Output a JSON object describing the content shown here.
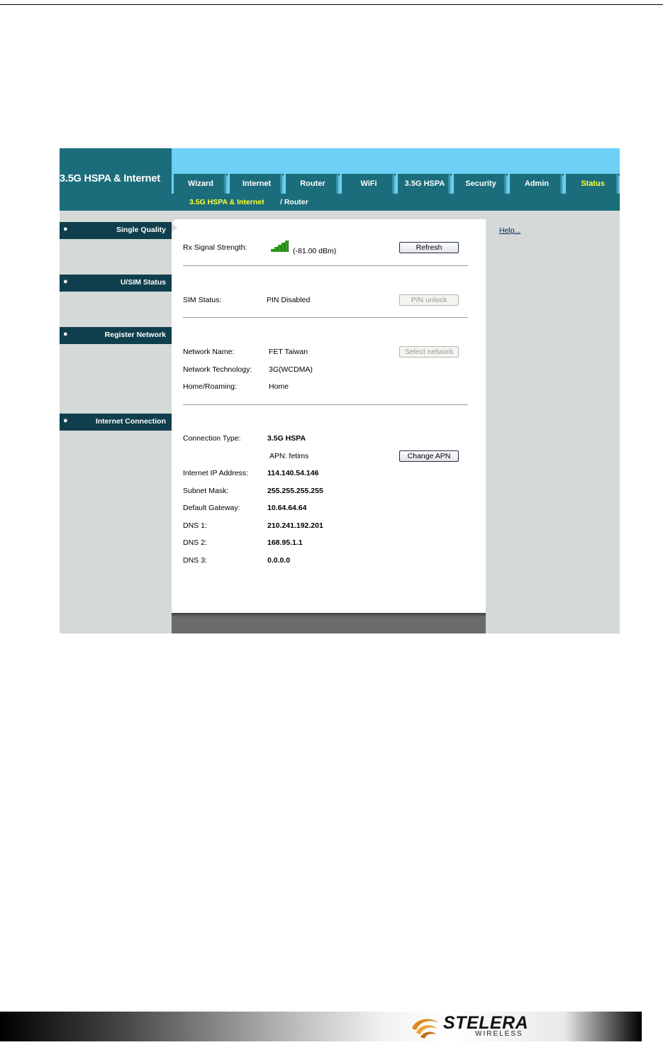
{
  "app": {
    "brand_title": "3.5G HSPA & Internet"
  },
  "tabs": [
    {
      "label": "Wizard"
    },
    {
      "label": "Internet"
    },
    {
      "label": "Router"
    },
    {
      "label": "WiFi"
    },
    {
      "label": "3.5G HSPA"
    },
    {
      "label": "Security"
    },
    {
      "label": "Admin"
    },
    {
      "label": "Status",
      "active": true
    }
  ],
  "subnav": {
    "current": "3.5G HSPA & Internet",
    "other": "/ Router"
  },
  "sidebar": {
    "sections": [
      {
        "label": "Single Quality"
      },
      {
        "label": "U/SIM Status"
      },
      {
        "label": "Register Network"
      },
      {
        "label": "Internet Connection"
      }
    ]
  },
  "help": {
    "link": "Help..."
  },
  "signal": {
    "label": "Rx Signal Strength:",
    "value": "(-81.00 dBm)",
    "bars": 5,
    "refresh_button": "Refresh"
  },
  "sim": {
    "label": "SIM Status:",
    "value": "PIN Disabled",
    "button": "PIN unlock"
  },
  "network": {
    "name_label": "Network Name:",
    "name_value": "FET Taiwan",
    "tech_label": "Network Technology:",
    "tech_value": "3G(WCDMA)",
    "roam_label": "Home/Roaming:",
    "roam_value": "Home",
    "button": "Select network"
  },
  "connection": {
    "type_label": "Connection Type:",
    "type_value": "3.5G HSPA",
    "apn_text": "APN: fetims",
    "apn_button": "Change APN",
    "ip_label": "Internet IP Address:",
    "ip_value": "114.140.54.146",
    "mask_label": "Subnet Mask:",
    "mask_value": "255.255.255.255",
    "gw_label": "Default Gateway:",
    "gw_value": "10.64.64.64",
    "dns1_label": "DNS 1:",
    "dns1_value": "210.241.192.201",
    "dns2_label": "DNS 2:",
    "dns2_value": "168.95.1.1",
    "dns3_label": "DNS 3:",
    "dns3_value": "0.0.0.0"
  },
  "footer_brand": {
    "name": "STELERA",
    "sub": "WIRELESS"
  },
  "colors": {
    "teal": "#1b6d7b",
    "sky": "#6dd0f5",
    "active_tab": "#ffff33",
    "signal_green": "#2f9e1e"
  }
}
